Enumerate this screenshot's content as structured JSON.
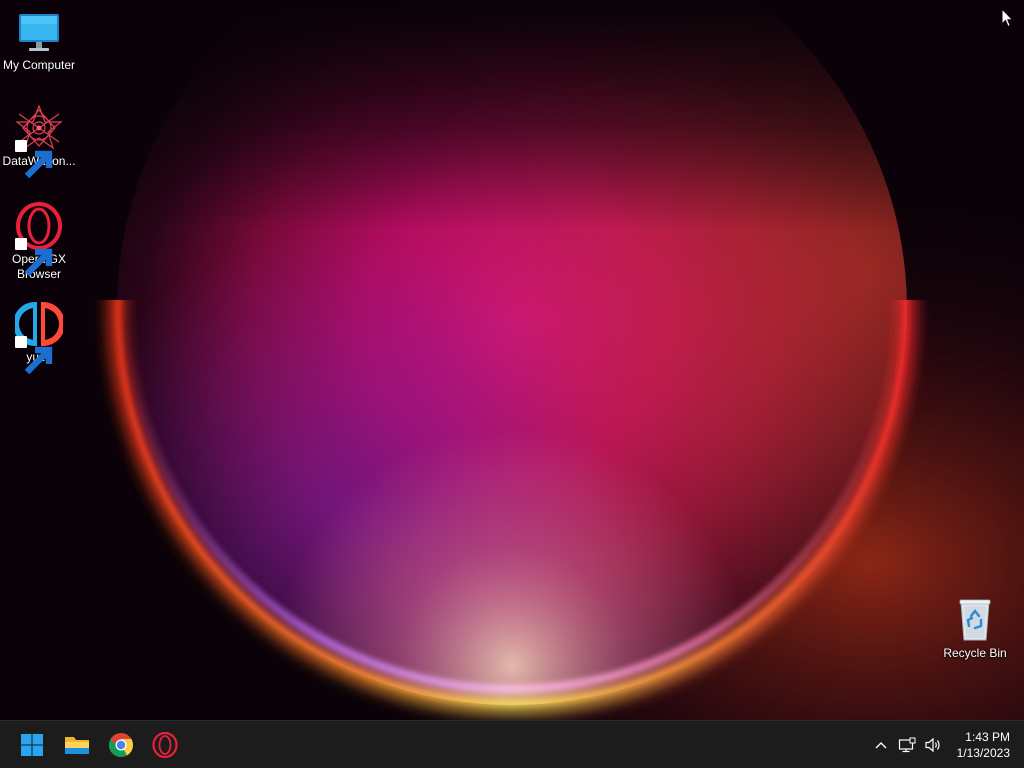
{
  "desktop": {
    "icons": [
      {
        "label": "My Computer",
        "icon": "monitor-icon",
        "shortcut": false
      },
      {
        "label": "DataWagon...",
        "icon": "datawagon-icon",
        "shortcut": true
      },
      {
        "label": "Opera GX Browser",
        "icon": "opera-gx-icon",
        "shortcut": true
      },
      {
        "label": "yuzu",
        "icon": "yuzu-icon",
        "shortcut": true
      },
      {
        "label": "Recycle Bin",
        "icon": "recycle-bin-icon",
        "shortcut": false
      }
    ]
  },
  "taskbar": {
    "pinned": [
      {
        "name": "Start",
        "icon": "windows-start-icon"
      },
      {
        "name": "File Explorer",
        "icon": "folder-icon"
      },
      {
        "name": "Google Chrome",
        "icon": "chrome-icon"
      },
      {
        "name": "Opera GX",
        "icon": "opera-gx-icon"
      }
    ],
    "tray": {
      "icons": [
        "chevron-up-icon",
        "network-icon",
        "volume-icon"
      ]
    },
    "clock": {
      "time": "1:43 PM",
      "date": "1/13/2023"
    }
  },
  "colors": {
    "taskbar_bg": "#1c1c1c",
    "accent_windows": "#2aa3f2",
    "opera_red": "#e0203c",
    "wallpaper_magenta": "#c0107a",
    "wallpaper_orange": "#ff6a2a",
    "wallpaper_yellow": "#ffd84a"
  }
}
